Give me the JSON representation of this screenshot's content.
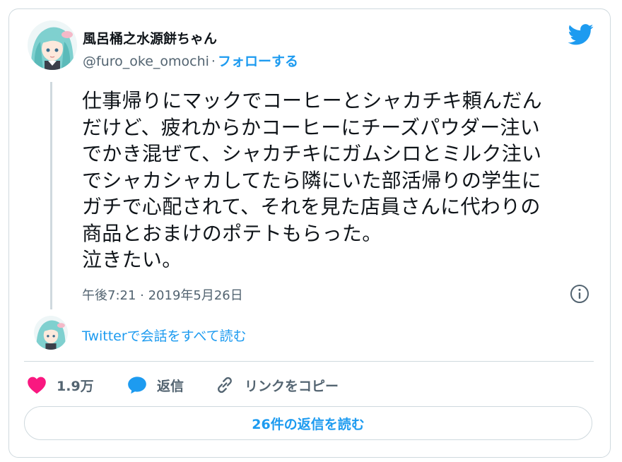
{
  "author": {
    "display_name": "風呂桶之水源餅ちゃん",
    "handle": "@furo_oke_omochi",
    "separator": "·",
    "follow_label": "フォローする"
  },
  "tweet": {
    "text": "仕事帰りにマックでコーヒーとシャカチキ頼んだん\nだけど、疲れからかコーヒーにチーズパウダー注い\nでかき混ぜて、シャカチキにガムシロとミルク注い\nでシャカシャカしてたら隣にいた部活帰りの学生に\nガチで心配されて、それを見た店員さんに代わりの\n商品とおまけのポテトもらった。\n泣きたい。",
    "timestamp": "午後7:21 · 2019年5月26日"
  },
  "thread": {
    "read_all_label": "Twitterで会話をすべて読む"
  },
  "actions": {
    "like_count": "1.9万",
    "reply_label": "返信",
    "copy_link_label": "リンクをコピー"
  },
  "footer": {
    "read_replies_label": "26件の返信を読む"
  },
  "icons": {
    "brand": "twitter-bird-icon",
    "info": "info-icon",
    "like": "heart-icon",
    "reply": "speech-bubble-icon",
    "link": "link-icon"
  },
  "colors": {
    "accent": "#1d9bf0",
    "like": "#f91880",
    "secondary_text": "#536471",
    "border": "#cfd9de"
  }
}
